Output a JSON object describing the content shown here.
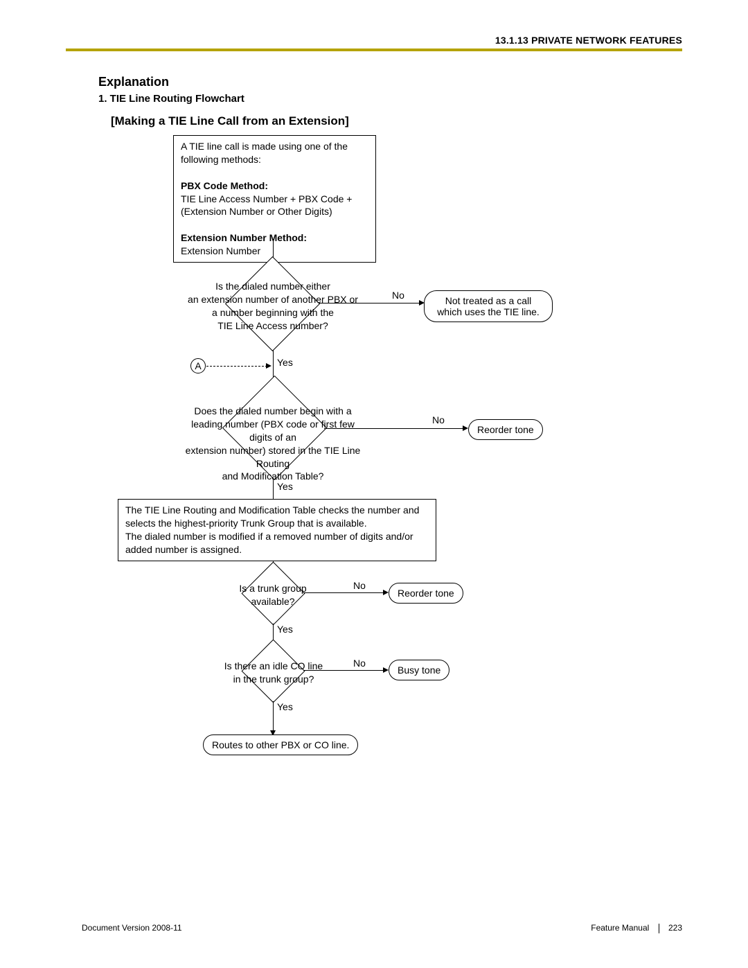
{
  "header": {
    "section": "13.1.13 PRIVATE NETWORK FEATURES"
  },
  "titles": {
    "explanation": "Explanation",
    "item": "1.  TIE Line Routing Flowchart",
    "sub": "[Making a TIE Line Call from an Extension]"
  },
  "intro": {
    "lead": "A TIE line call is made using one of the following methods:",
    "m1_title": "PBX Code Method:",
    "m1_body": "TIE Line Access Number + PBX Code + (Extension Number or Other Digits)",
    "m2_title": "Extension Number Method:",
    "m2_body": "Extension Number"
  },
  "d1": {
    "text": "Is the dialed number either\nan extension number of another PBX or\na number beginning with the\nTIE Line Access number?",
    "no": "No",
    "yes": "Yes"
  },
  "t1": "Not treated as a call which uses the TIE line.",
  "conn": "A",
  "d2": {
    "text": "Does the dialed number begin with a\nleading number (PBX code or first few digits of an\nextension number) stored in the TIE Line Routing\nand Modification Table?",
    "no": "No",
    "yes": "Yes"
  },
  "t2": "Reorder tone",
  "proc": "The TIE Line Routing and Modification Table checks the number and selects the highest-priority Trunk Group that is available.\nThe dialed number is modified if a removed number of digits and/or added number is assigned.",
  "d3": {
    "text": "Is a trunk group\navailable?",
    "no": "No",
    "yes": "Yes"
  },
  "t3": "Reorder tone",
  "d4": {
    "text": "Is there an idle CO line\nin the trunk group?",
    "no": "No",
    "yes": "Yes"
  },
  "t4": "Busy tone",
  "t5": "Routes to other PBX or CO line.",
  "footer": {
    "left": "Document Version  2008-11",
    "right_a": "Feature Manual",
    "right_b": "223"
  }
}
